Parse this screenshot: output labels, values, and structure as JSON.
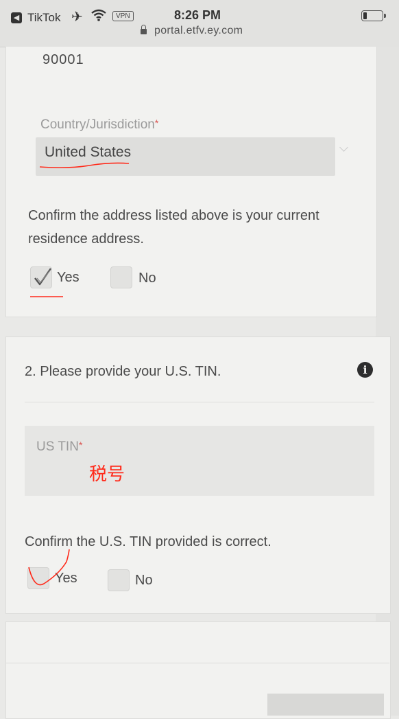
{
  "status_bar": {
    "back_app": "TikTok",
    "vpn": "VPN",
    "time": "8:26 PM",
    "url": "portal.etfv.ey.com",
    "battery_level": 0.2
  },
  "address": {
    "zip": "90001",
    "country_label": "Country/Jurisdiction",
    "required_mark": "*",
    "country_value": "United States",
    "confirm_question": "Confirm the address listed above is your current residence address.",
    "options": [
      {
        "label": "Yes",
        "checked": true
      },
      {
        "label": "No",
        "checked": false
      }
    ]
  },
  "tin": {
    "title": "2. Please provide your U.S. TIN.",
    "info_glyph": "i",
    "field_label": "US TIN",
    "required_mark": "*",
    "annotation": "税号",
    "confirm_question": "Confirm the U.S. TIN provided is correct.",
    "options": [
      {
        "label": "Yes",
        "checked": false
      },
      {
        "label": "No",
        "checked": false
      }
    ]
  },
  "colors": {
    "annotation_red": "#ff2a1a",
    "required_red": "#d9534f"
  }
}
